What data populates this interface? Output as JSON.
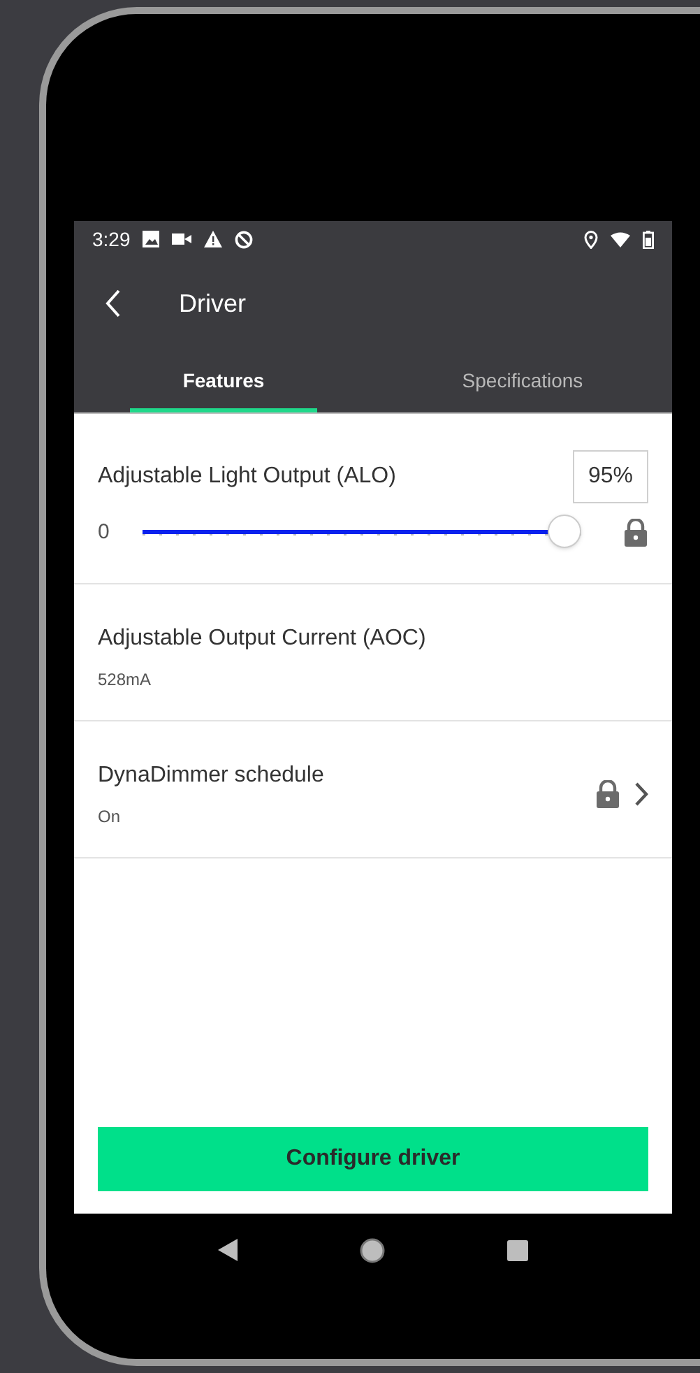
{
  "status_bar": {
    "time": "3:29"
  },
  "app_bar": {
    "title": "Driver"
  },
  "tabs": [
    {
      "label": "Features",
      "selected": true
    },
    {
      "label": "Specifications",
      "selected": false
    }
  ],
  "features": [
    {
      "kind": "slider",
      "title": "Adjustable Light Output (ALO)",
      "value": "95%",
      "min_label": "0",
      "level": 0.95,
      "locked": true
    },
    {
      "kind": "value",
      "title": "Adjustable Output Current (AOC)",
      "subtitle": "528mA",
      "locked": false
    },
    {
      "kind": "link",
      "title": "DynaDimmer schedule",
      "subtitle": "On",
      "locked": true
    }
  ],
  "primary_button": "Configure driver"
}
